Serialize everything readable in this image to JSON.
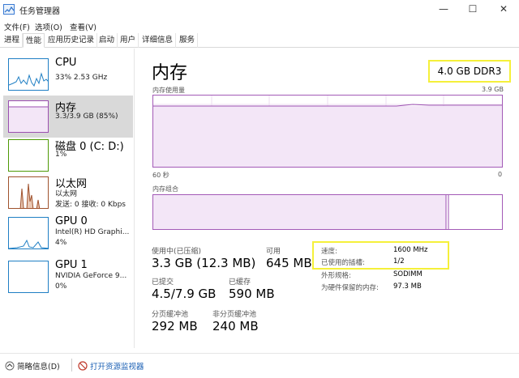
{
  "window": {
    "title": "任务管理器",
    "minimize_glyph": "—",
    "maximize_glyph": "☐",
    "close_glyph": "✕"
  },
  "menu": [
    "文件(F)",
    "选项(O)",
    "查看(V)"
  ],
  "tabs": [
    {
      "label": "进程",
      "active": false
    },
    {
      "label": "性能",
      "active": true
    },
    {
      "label": "应用历史记录",
      "active": false
    },
    {
      "label": "启动",
      "active": false
    },
    {
      "label": "用户",
      "active": false
    },
    {
      "label": "详细信息",
      "active": false
    },
    {
      "label": "服务",
      "active": false
    }
  ],
  "resources": [
    {
      "name": "CPU",
      "sub1": "33% 2.53 GHz",
      "sub2": "",
      "sub3": "",
      "color": "#1f7fc4"
    },
    {
      "name": "内存",
      "sub1": "3.3/3.9 GB (85%)",
      "sub2": "",
      "sub3": "",
      "color": "#9b4fb0"
    },
    {
      "name": "磁盘 0 (C: D:)",
      "sub1": "1%",
      "sub2": "",
      "sub3": "",
      "color": "#4e9a06"
    },
    {
      "name": "以太网",
      "sub1": "以太网",
      "sub2": "发送: 0 接收: 0 Kbps",
      "sub3": "",
      "color": "#a0522d"
    },
    {
      "name": "GPU 0",
      "sub1": "Intel(R) HD Graphi...",
      "sub2": "4%",
      "sub3": "",
      "color": "#1f7fc4"
    },
    {
      "name": "GPU 1",
      "sub1": "NVIDIA GeForce 9...",
      "sub2": "0%",
      "sub3": "",
      "color": "#1f7fc4"
    }
  ],
  "memory": {
    "title": "内存",
    "spec": "4.0 GB DDR3",
    "usage_label": "内存使用量",
    "usage_max": "3.9 GB",
    "time_left": "60 秒",
    "time_right": "0",
    "composition_label": "内存组合",
    "usage_fraction": 0.85,
    "stats": {
      "in_use_label": "使用中(已压缩)",
      "in_use_value": "3.3 GB (12.3 MB)",
      "available_label": "可用",
      "available_value": "645 MB",
      "committed_label": "已提交",
      "committed_value": "4.5/7.9 GB",
      "cached_label": "已缓存",
      "cached_value": "590 MB",
      "paged_label": "分页缓冲池",
      "paged_value": "292 MB",
      "nonpaged_label": "非分页缓冲池",
      "nonpaged_value": "240 MB"
    },
    "details": {
      "speed_label": "速度:",
      "speed_value": "1600 MHz",
      "slots_label": "已使用的插槽:",
      "slots_value": "1/2",
      "form_label": "外形规格:",
      "form_value": "SODIMM",
      "reserved_label": "为硬件保留的内存:",
      "reserved_value": "97.3 MB"
    }
  },
  "footer": {
    "fewer_details": "简略信息(D)",
    "open_monitor": "打开资源监视器"
  }
}
